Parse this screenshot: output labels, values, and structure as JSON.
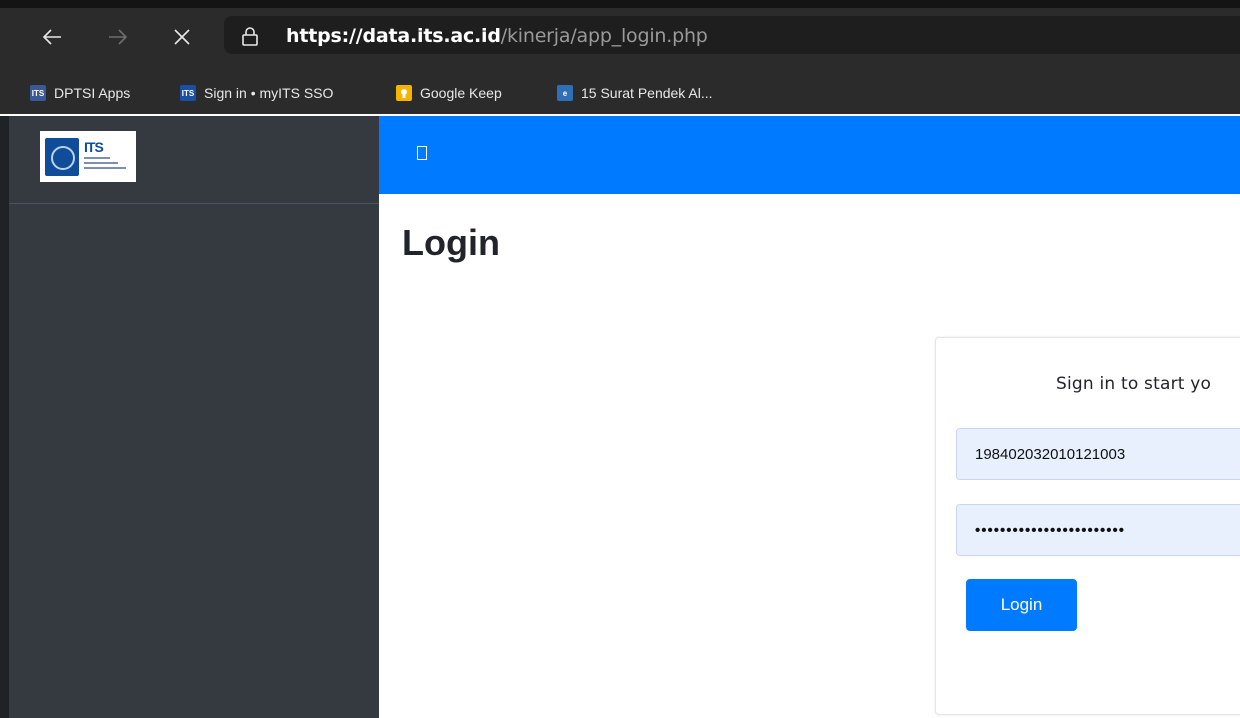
{
  "browser": {
    "url_scheme": "https://",
    "url_host": "data.its.ac.id",
    "url_path": "/kinerja/app_login.php",
    "nav": {
      "back_icon": "arrow-left-icon",
      "forward_icon": "arrow-right-icon",
      "stop_icon": "close-icon",
      "lock_icon": "lock-icon"
    },
    "bookmarks": [
      {
        "label": "DPTSI Apps",
        "icon": "its-icon"
      },
      {
        "label": "Sign in • myITS SSO",
        "icon": "its-icon"
      },
      {
        "label": "Google Keep",
        "icon": "google-keep-icon"
      },
      {
        "label": "15 Surat Pendek Al...",
        "icon": "bookmark-icon"
      }
    ]
  },
  "page": {
    "logo_text": "ITS",
    "title": "Login",
    "login": {
      "message": "Sign in to start yo",
      "username_value": "198402032010121003",
      "password_value": "••••••••••••••••••••••••",
      "submit_label": "Login"
    }
  },
  "colors": {
    "navbar": "#007bff",
    "sidebar": "#343a40",
    "browser_chrome": "#2b2b2b",
    "input_autofill": "#e8f0fe",
    "button": "#007bff"
  }
}
